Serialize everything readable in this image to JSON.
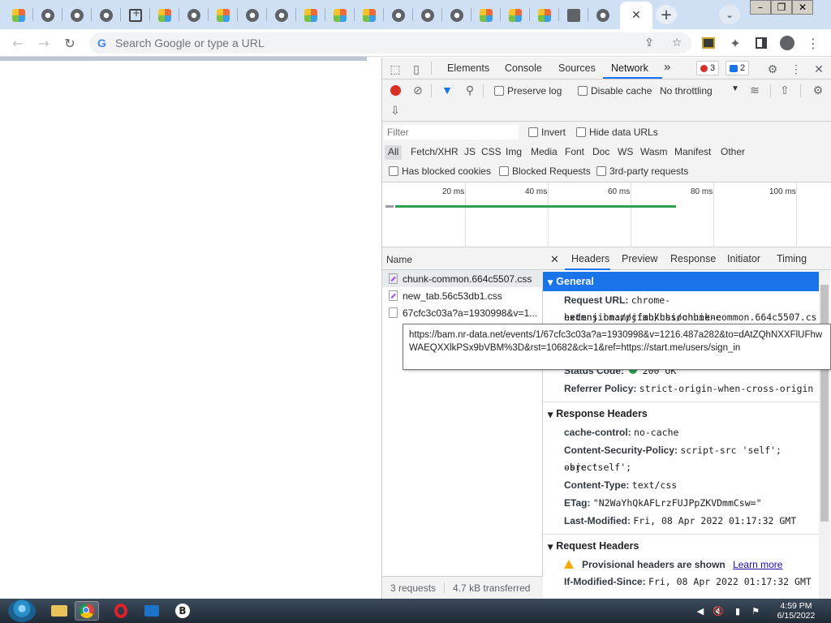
{
  "browser": {
    "tabs_count": 22,
    "active_tab_close": "✕",
    "new_tab": "+",
    "window_controls": [
      "–",
      "❐",
      "✕"
    ]
  },
  "toolbar": {
    "back": "←",
    "forward": "→",
    "reload": "↻",
    "google_g": "G",
    "omnibox_placeholder": "Search Google or type a URL",
    "share": "⇪",
    "star": "☆",
    "extensions": "✦",
    "menu": "⋮"
  },
  "devtools": {
    "tabs": [
      "Elements",
      "Console",
      "Sources",
      "Network"
    ],
    "more_tabs": "»",
    "error_count": "3",
    "message_count": "2",
    "network_toolbar": {
      "preserve_log": "Preserve log",
      "disable_cache": "Disable cache",
      "throttling": "No throttling"
    },
    "filter": {
      "placeholder": "Filter",
      "invert": "Invert",
      "hide_data_urls": "Hide data URLs",
      "types": [
        "All",
        "Fetch/XHR",
        "JS",
        "CSS",
        "Img",
        "Media",
        "Font",
        "Doc",
        "WS",
        "Wasm",
        "Manifest",
        "Other"
      ],
      "has_blocked_cookies": "Has blocked cookies",
      "blocked_requests": "Blocked Requests",
      "third_party": "3rd-party requests"
    },
    "timeline": {
      "labels": [
        "20 ms",
        "40 ms",
        "60 ms",
        "80 ms",
        "100 ms"
      ]
    },
    "requests": {
      "column": "Name",
      "items": [
        {
          "name": "chunk-common.664c5507.css",
          "type": "css"
        },
        {
          "name": "new_tab.56c53db1.css",
          "type": "css"
        },
        {
          "name": "67cfc3c03a?a=1930998&v=1...",
          "type": "other"
        }
      ],
      "summary_count": "3 requests",
      "summary_transferred": "4.7 kB transferred"
    },
    "detail": {
      "close": "✕",
      "tabs": [
        "Headers",
        "Preview",
        "Response",
        "Initiator",
        "Timing"
      ],
      "general": {
        "title": "General",
        "request_url_key": "Request URL:",
        "request_url_val_1": "chrome-extension://cfmnkhhioonhiene",
        "request_url_val_2": "hedmnjibmampjiab/css/chunk-common.664c5507.cs",
        "status_key": "Status Code:",
        "status_val": "200 OK",
        "referrer_key": "Referrer Policy:",
        "referrer_val": "strict-origin-when-cross-origin"
      },
      "response_headers": {
        "title": "Response Headers",
        "cache_key": "cache-control:",
        "cache_val": "no-cache",
        "csp_key": "Content-Security-Policy:",
        "csp_val_1": "script-src 'self'; object",
        "csp_val_2": "-src 'self';",
        "ctype_key": "Content-Type:",
        "ctype_val": "text/css",
        "etag_key": "ETag:",
        "etag_val": "\"N2WaYhQkAFLrzFUJPpZKVDmmCsw=\"",
        "lastmod_key": "Last-Modified:",
        "lastmod_val": "Fri, 08 Apr 2022 01:17:32 GMT"
      },
      "request_headers": {
        "title": "Request Headers",
        "provisional": "Provisional headers are shown",
        "learn_more": "Learn more",
        "ims_key": "If-Modified-Since:",
        "ims_val": "Fri, 08 Apr 2022 01:17:32 GMT"
      }
    },
    "tooltip": "https://bam.nr-data.net/events/1/67cfc3c03a?a=1930998&v=1216.487a282&to=dAtZQhNXXFlUFhwWAEQXXlkPSx9bVBM%3D&rst=10682&ck=1&ref=https://start.me/users/sign_in"
  },
  "taskbar": {
    "time": "4:59 PM",
    "date": "6/15/2022"
  },
  "colors": {
    "accent": "#1a73e8",
    "record_red": "#d93025",
    "timeline_green": "#2e9e4f"
  }
}
